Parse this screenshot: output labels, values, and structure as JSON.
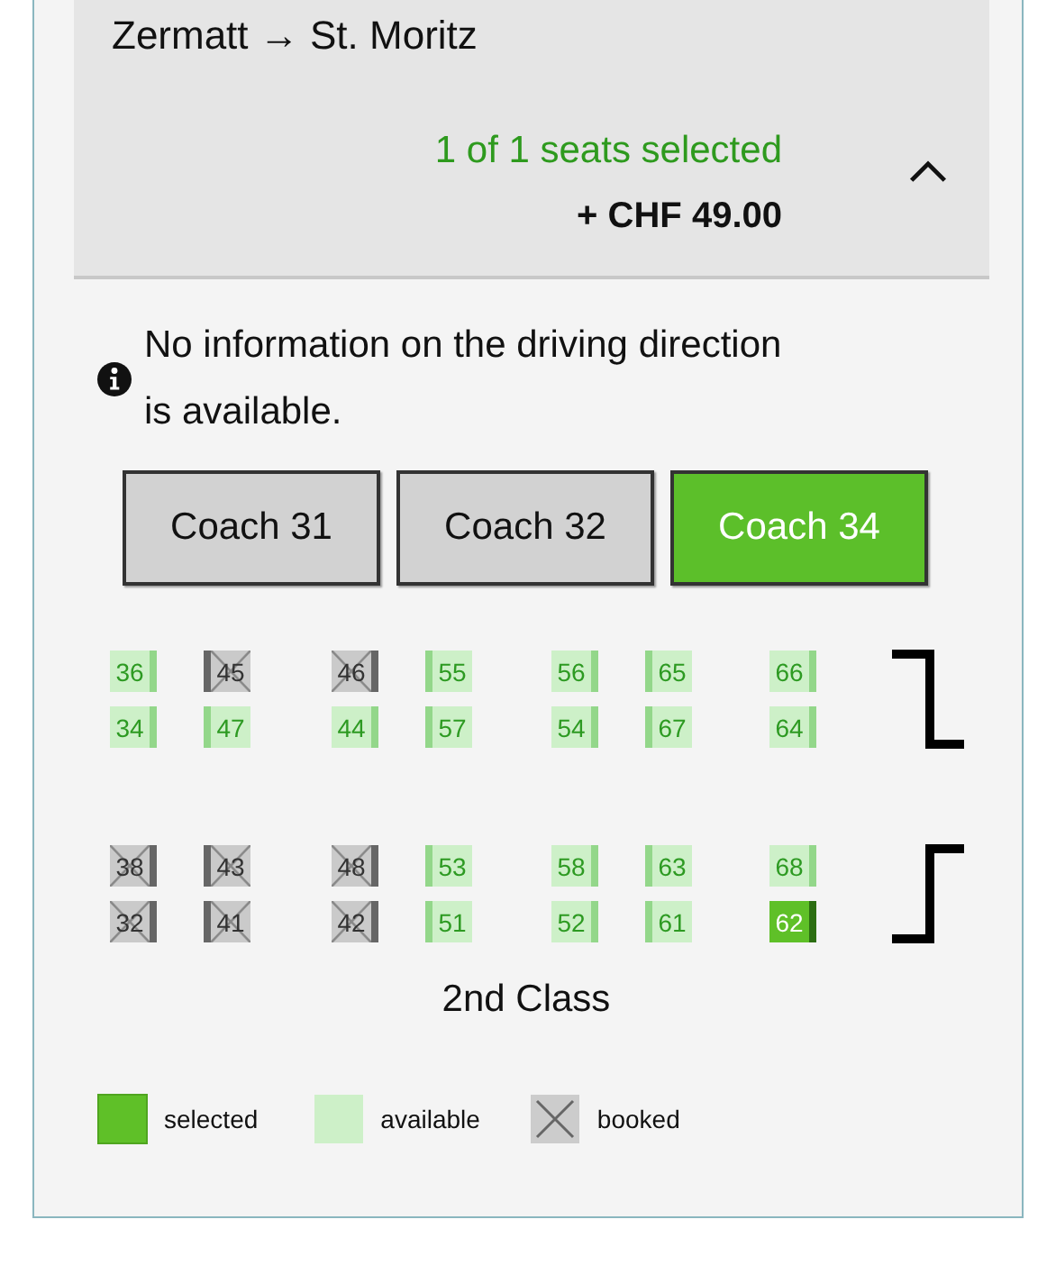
{
  "header": {
    "route": "Zermatt → St. Moritz",
    "selection_status": "1 of 1 seats selected",
    "price": "+ CHF 49.00",
    "expanded": true
  },
  "notice": "No information on the driving direction is available.",
  "coaches": [
    {
      "label": "Coach 31",
      "selected": false
    },
    {
      "label": "Coach 32",
      "selected": false
    },
    {
      "label": "Coach 34",
      "selected": true
    }
  ],
  "seat_groups": [
    {
      "rows": [
        [
          {
            "number": "36",
            "booked": false,
            "selected": false
          },
          {
            "number": "45",
            "booked": true,
            "selected": false
          },
          {
            "number": "46",
            "booked": true,
            "selected": false
          },
          {
            "number": "55",
            "booked": false,
            "selected": false
          },
          {
            "number": "56",
            "booked": false,
            "selected": false
          },
          {
            "number": "65",
            "booked": false,
            "selected": false
          },
          {
            "number": "66",
            "booked": false,
            "selected": false
          }
        ],
        [
          {
            "number": "34",
            "booked": false,
            "selected": false
          },
          {
            "number": "47",
            "booked": false,
            "selected": false
          },
          {
            "number": "44",
            "booked": false,
            "selected": false
          },
          {
            "number": "57",
            "booked": false,
            "selected": false
          },
          {
            "number": "54",
            "booked": false,
            "selected": false
          },
          {
            "number": "67",
            "booked": false,
            "selected": false
          },
          {
            "number": "64",
            "booked": false,
            "selected": false
          }
        ]
      ]
    },
    {
      "rows": [
        [
          {
            "number": "38",
            "booked": true,
            "selected": false
          },
          {
            "number": "43",
            "booked": true,
            "selected": false
          },
          {
            "number": "48",
            "booked": true,
            "selected": false
          },
          {
            "number": "53",
            "booked": false,
            "selected": false
          },
          {
            "number": "58",
            "booked": false,
            "selected": false
          },
          {
            "number": "63",
            "booked": false,
            "selected": false
          },
          {
            "number": "68",
            "booked": false,
            "selected": false
          }
        ],
        [
          {
            "number": "32",
            "booked": true,
            "selected": false
          },
          {
            "number": "41",
            "booked": true,
            "selected": false
          },
          {
            "number": "42",
            "booked": true,
            "selected": false
          },
          {
            "number": "51",
            "booked": false,
            "selected": false
          },
          {
            "number": "52",
            "booked": false,
            "selected": false
          },
          {
            "number": "61",
            "booked": false,
            "selected": false
          },
          {
            "number": "62",
            "booked": false,
            "selected": true
          }
        ]
      ]
    }
  ],
  "class_label": "2nd Class",
  "legend": [
    {
      "kind": "selected",
      "label": "selected"
    },
    {
      "kind": "available",
      "label": "available"
    },
    {
      "kind": "booked",
      "label": "booked"
    }
  ]
}
